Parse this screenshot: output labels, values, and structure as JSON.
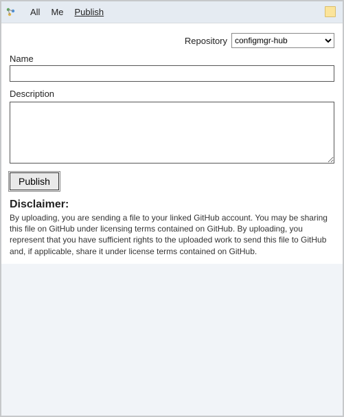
{
  "toolbar": {
    "tabs": [
      "All",
      "Me",
      "Publish"
    ],
    "active_index": 2
  },
  "repository": {
    "label": "Repository",
    "options": [
      "configmgr-hub"
    ],
    "selected": "configmgr-hub"
  },
  "name": {
    "label": "Name",
    "value": ""
  },
  "description": {
    "label": "Description",
    "value": ""
  },
  "publish_button": "Publish",
  "disclaimer": {
    "heading": "Disclaimer:",
    "text": "By uploading, you are sending a file to your linked GitHub account. You may be sharing this file on GitHub under licensing terms contained on GitHub. By uploading, you represent that you have sufficient rights to the uploaded work to send this file to GitHub and, if applicable, share it under license terms contained on GitHub."
  }
}
